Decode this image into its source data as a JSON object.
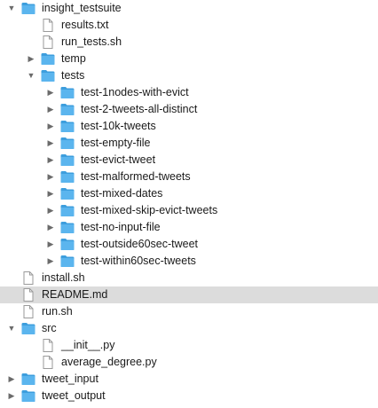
{
  "icons": {
    "folder": "folder-icon",
    "file": "document-icon",
    "expanded": "disclosure-triangle-down-icon",
    "collapsed": "disclosure-triangle-right-icon"
  },
  "colors": {
    "folder_front": "#5bb5ee",
    "folder_back": "#3d9edd",
    "selected_row": "#dcdcdc",
    "disclosure": "#6b6b6b"
  },
  "tree": [
    {
      "label": "insight_testsuite",
      "type": "folder",
      "depth": 0,
      "state": "expanded"
    },
    {
      "label": "results.txt",
      "type": "file",
      "depth": 1
    },
    {
      "label": "run_tests.sh",
      "type": "file",
      "depth": 1
    },
    {
      "label": "temp",
      "type": "folder",
      "depth": 1,
      "state": "collapsed"
    },
    {
      "label": "tests",
      "type": "folder",
      "depth": 1,
      "state": "expanded"
    },
    {
      "label": "test-1nodes-with-evict",
      "type": "folder",
      "depth": 2,
      "state": "collapsed"
    },
    {
      "label": "test-2-tweets-all-distinct",
      "type": "folder",
      "depth": 2,
      "state": "collapsed"
    },
    {
      "label": "test-10k-tweets",
      "type": "folder",
      "depth": 2,
      "state": "collapsed"
    },
    {
      "label": "test-empty-file",
      "type": "folder",
      "depth": 2,
      "state": "collapsed"
    },
    {
      "label": "test-evict-tweet",
      "type": "folder",
      "depth": 2,
      "state": "collapsed"
    },
    {
      "label": "test-malformed-tweets",
      "type": "folder",
      "depth": 2,
      "state": "collapsed"
    },
    {
      "label": "test-mixed-dates",
      "type": "folder",
      "depth": 2,
      "state": "collapsed"
    },
    {
      "label": "test-mixed-skip-evict-tweets",
      "type": "folder",
      "depth": 2,
      "state": "collapsed"
    },
    {
      "label": "test-no-input-file",
      "type": "folder",
      "depth": 2,
      "state": "collapsed"
    },
    {
      "label": "test-outside60sec-tweet",
      "type": "folder",
      "depth": 2,
      "state": "collapsed"
    },
    {
      "label": "test-within60sec-tweets",
      "type": "folder",
      "depth": 2,
      "state": "collapsed"
    },
    {
      "label": "install.sh",
      "type": "file",
      "depth": 0
    },
    {
      "label": "README.md",
      "type": "file",
      "depth": 0,
      "selected": true
    },
    {
      "label": "run.sh",
      "type": "file",
      "depth": 0
    },
    {
      "label": "src",
      "type": "folder",
      "depth": 0,
      "state": "expanded"
    },
    {
      "label": "__init__.py",
      "type": "file",
      "depth": 1
    },
    {
      "label": "average_degree.py",
      "type": "file",
      "depth": 1
    },
    {
      "label": "tweet_input",
      "type": "folder",
      "depth": 0,
      "state": "collapsed"
    },
    {
      "label": "tweet_output",
      "type": "folder",
      "depth": 0,
      "state": "collapsed"
    }
  ]
}
